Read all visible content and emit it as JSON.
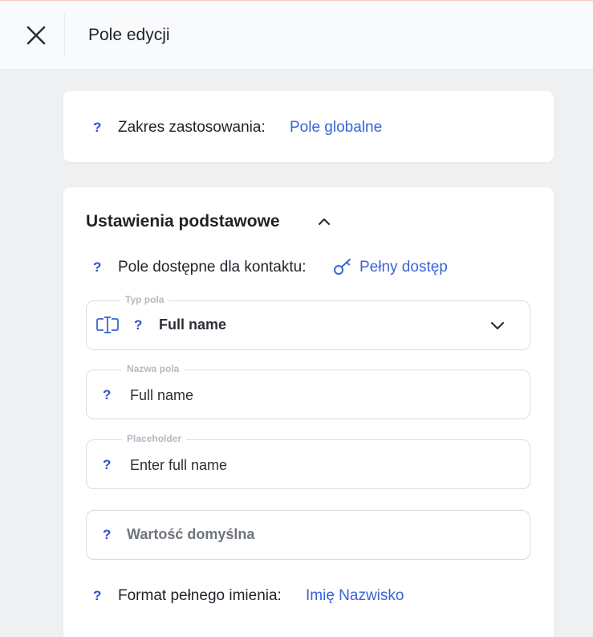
{
  "header": {
    "title": "Pole edycji"
  },
  "scope": {
    "label": "Zakres zastosowania:",
    "value": "Pole globalne",
    "help": "?"
  },
  "basic": {
    "title": "Ustawienia podstawowe",
    "access": {
      "label": "Pole dostępne dla kontaktu:",
      "value": "Pełny dostęp",
      "help": "?"
    },
    "field_type": {
      "label": "Typ pola",
      "value": "Full name",
      "help": "?"
    },
    "field_name": {
      "label": "Nazwa pola",
      "value": "Full name",
      "help": "?"
    },
    "placeholder": {
      "label": "Placeholder",
      "value": "Enter full name",
      "help": "?"
    },
    "default_value": {
      "placeholder": "Wartość domyślna",
      "help": "?"
    },
    "name_format": {
      "label": "Format pełnego imienia:",
      "value": "Imię Nazwisko",
      "help": "?"
    }
  },
  "icons": {
    "close": "close-icon",
    "collapse": "chevron-up-icon",
    "key": "key-icon",
    "text_field": "text-field-icon",
    "dropdown": "chevron-down-icon"
  },
  "colors": {
    "link": "#3a64d8",
    "help": "#2f50c8",
    "background": "#eef0f2"
  }
}
